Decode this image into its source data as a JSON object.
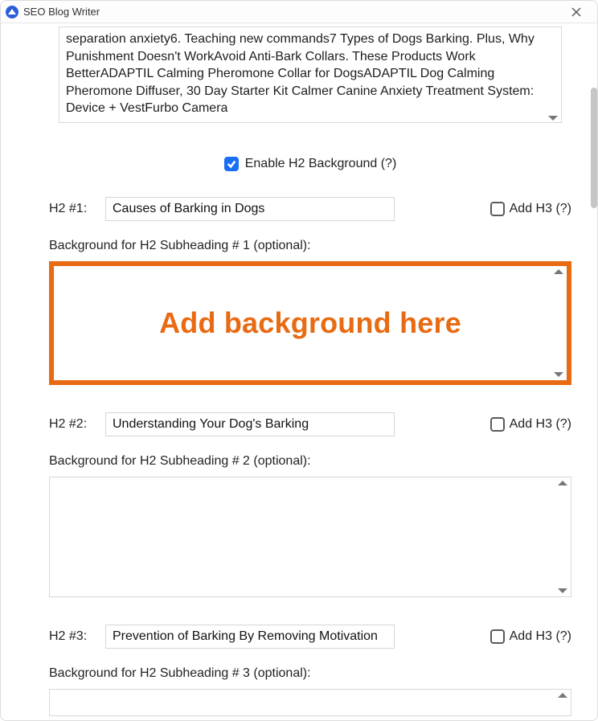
{
  "window": {
    "title": "SEO Blog Writer"
  },
  "top_text": "separation anxiety6. Teaching new commands7 Types of Dogs Barking. Plus, Why Punishment Doesn't WorkAvoid Anti-Bark Collars. These Products Work BetterADAPTIL Calming Pheromone Collar for DogsADAPTIL Dog Calming Pheromone Diffuser, 30 Day Starter Kit Calmer Canine Anxiety Treatment System: Device + VestFurbo Camera",
  "enable_h2_bg": {
    "label": "Enable H2 Background (?)",
    "checked": true
  },
  "add_h3_label": "Add H3 (?)",
  "overlay": "Add background here",
  "sections": [
    {
      "row_label": "H2 #1:",
      "input_value": "Causes of Barking in Dogs",
      "add_h3_checked": false,
      "bg_label": "Background for H2 Subheading # 1 (optional):",
      "highlight": true
    },
    {
      "row_label": "H2 #2:",
      "input_value": "Understanding Your Dog's Barking",
      "add_h3_checked": false,
      "bg_label": "Background for H2 Subheading # 2 (optional):",
      "highlight": false
    },
    {
      "row_label": "H2 #3:",
      "input_value": "Prevention of Barking By Removing Motivation",
      "add_h3_checked": false,
      "bg_label": "Background for H2 Subheading # 3 (optional):",
      "highlight": false,
      "partial": true
    }
  ]
}
